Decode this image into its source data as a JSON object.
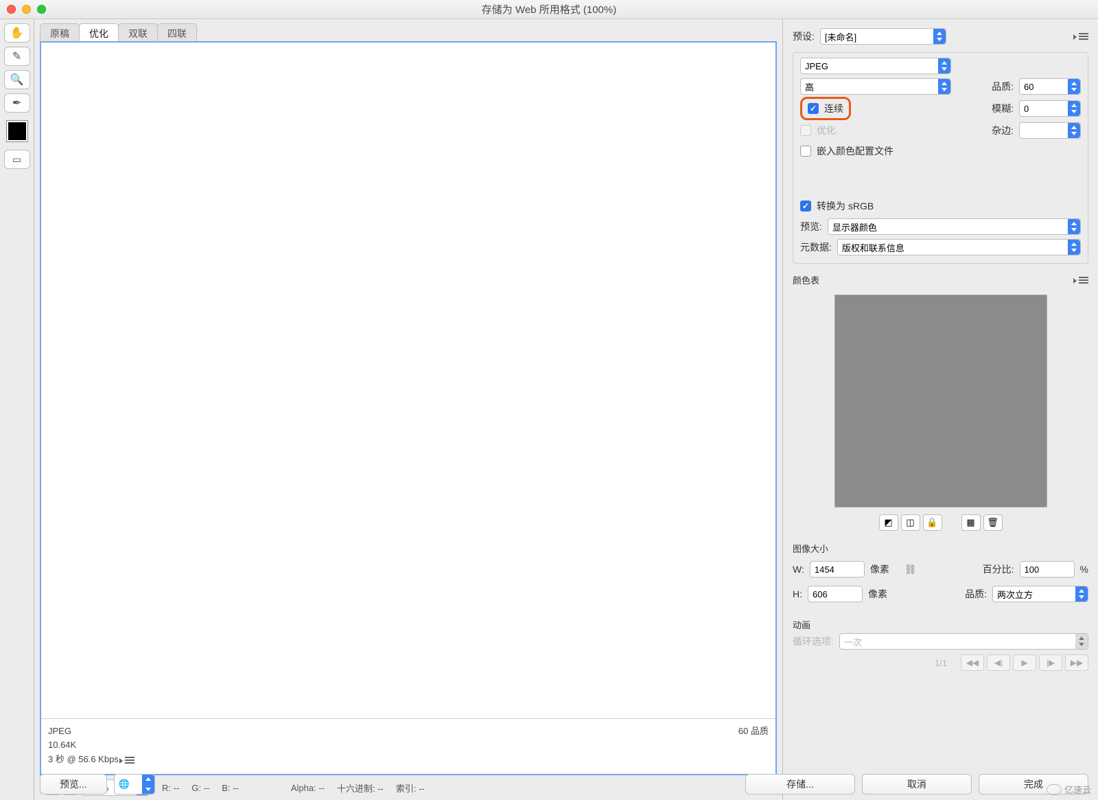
{
  "window": {
    "title": "存储为 Web 所用格式 (100%)"
  },
  "tabs": {
    "items": [
      "原稿",
      "优化",
      "双联",
      "四联"
    ],
    "active_index": 1
  },
  "canvas_info": {
    "format": "JPEG",
    "size": "10.64K",
    "time": "3 秒 @ 56.6 Kbps",
    "quality_label": "60 品质"
  },
  "zoom": {
    "value": "100%"
  },
  "colorbar": {
    "r": "R: --",
    "g": "G: --",
    "b": "B: --",
    "alpha": "Alpha: --",
    "hex": "十六进制: --",
    "index": "索引: --"
  },
  "right": {
    "preset_label": "预设:",
    "preset_value": "[未命名]",
    "format": "JPEG",
    "quality_preset": "高",
    "quality_label": "品质:",
    "quality_value": "60",
    "blur_label": "模糊:",
    "blur_value": "0",
    "matte_label": "杂边:",
    "matte_value": "",
    "progressive": "连续",
    "optimized": "优化",
    "embed_profile": "嵌入颜色配置文件",
    "convert_srgb": "转换为 sRGB",
    "preview_label": "预览:",
    "preview_value": "显示器颜色",
    "metadata_label": "元数据:",
    "metadata_value": "版权和联系信息",
    "color_table_label": "颜色表",
    "image_size_label": "图像大小",
    "w_label": "W:",
    "w_value": "1454",
    "h_label": "H:",
    "h_value": "606",
    "px": "像素",
    "percent_label": "百分比:",
    "percent_value": "100",
    "percent_suffix": "%",
    "resample_label": "品质:",
    "resample_value": "两次立方",
    "anim_label": "动画",
    "loop_label": "循环选项:",
    "loop_value": "一次",
    "frame": "1/1"
  },
  "footer": {
    "preview": "预览...",
    "save": "存储...",
    "cancel": "取消",
    "done": "完成"
  },
  "watermark": "亿速云"
}
